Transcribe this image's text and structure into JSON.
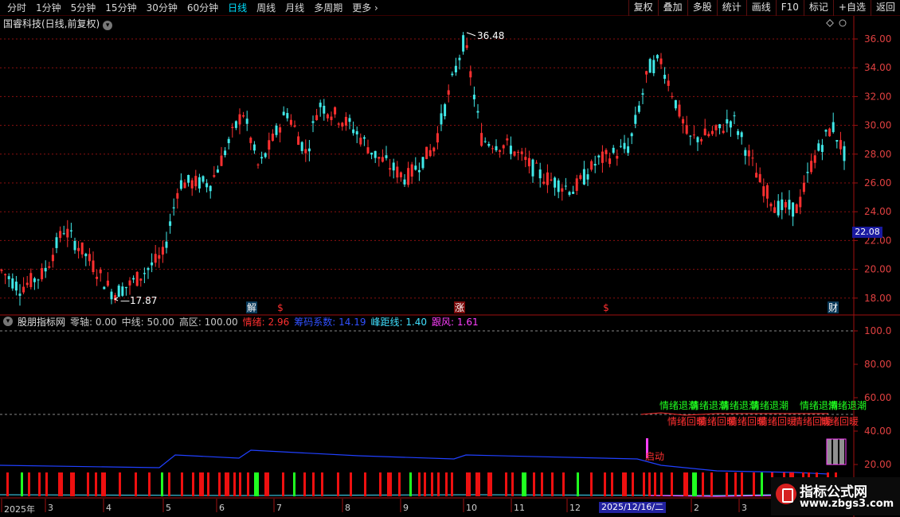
{
  "toolbar": {
    "periods": [
      "分时",
      "1分钟",
      "5分钟",
      "15分钟",
      "30分钟",
      "60分钟",
      "日线",
      "周线",
      "月线",
      "多周期",
      "更多"
    ],
    "active_period": "日线",
    "actions": [
      "复权",
      "叠加",
      "多股",
      "统计",
      "画线",
      "F10",
      "标记",
      "+自选",
      "返回"
    ]
  },
  "stock": {
    "title": "国睿科技(日线,前复权)",
    "current_price_tag": "22.08",
    "max_annotation": "36.48",
    "min_annotation": "17.87"
  },
  "price_axis": {
    "ticks": [
      "36.00",
      "34.00",
      "32.00",
      "30.00",
      "28.00",
      "26.00",
      "24.00",
      "22.00",
      "20.00",
      "18.00"
    ]
  },
  "event_markers": [
    "解",
    "$",
    "涨",
    "$",
    "财"
  ],
  "indicator": {
    "name": "股朋指标网",
    "params": [
      {
        "label": "零轴: 0.00",
        "color": "#c8c8c8"
      },
      {
        "label": "中线: 50.00",
        "color": "#c8c8c8"
      },
      {
        "label": "高区: 100.00",
        "color": "#c8c8c8"
      },
      {
        "label": "情绪: 2.96",
        "color": "#ff3030"
      },
      {
        "label": "筹码系数: 14.19",
        "color": "#3050ff"
      },
      {
        "label": "峰距线: 1.40",
        "color": "#40e0ff"
      },
      {
        "label": "跟风: 1.61",
        "color": "#ff40ff"
      }
    ],
    "axis_ticks": [
      "100.0",
      "80.00",
      "60.00",
      "40.00",
      "20.00"
    ],
    "text_green": "情绪退潮",
    "text_red": "情绪回暖",
    "text_start": "启动"
  },
  "dates": {
    "labels": [
      "2025年",
      "3",
      "4",
      "5",
      "6",
      "7",
      "8",
      "9",
      "10",
      "11",
      "12",
      "2",
      "3"
    ],
    "selected": "2025/12/16/二"
  },
  "watermark": {
    "title": "指标公式网",
    "url": "www.zbgs3.com"
  },
  "colors": {
    "up": "#ff3030",
    "down": "#40e8e8",
    "grid": "#8a1010",
    "blue_line": "#2040ff"
  }
}
